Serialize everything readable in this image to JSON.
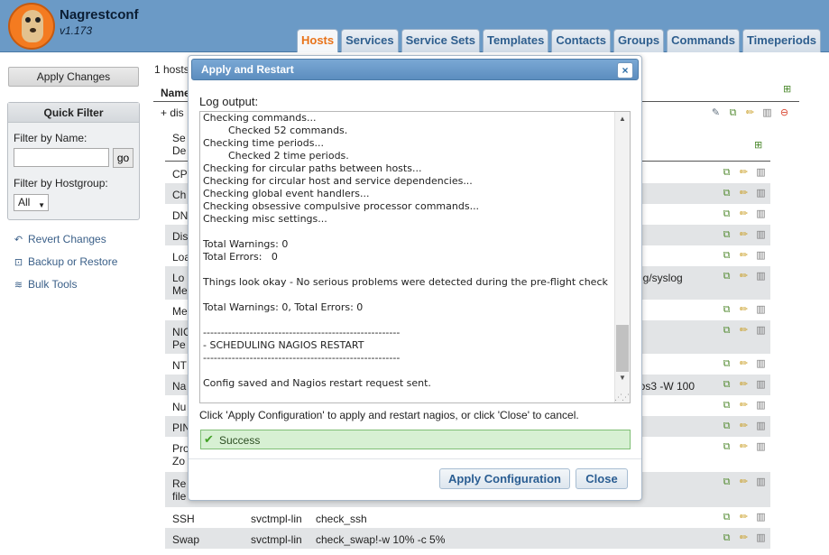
{
  "app": {
    "title": "Nagrestconf",
    "version": "v1.173"
  },
  "tabs": [
    {
      "label": "Hosts",
      "active": true
    },
    {
      "label": "Services",
      "active": false
    },
    {
      "label": "Service Sets",
      "active": false
    },
    {
      "label": "Templates",
      "active": false
    },
    {
      "label": "Contacts",
      "active": false
    },
    {
      "label": "Groups",
      "active": false
    },
    {
      "label": "Commands",
      "active": false
    },
    {
      "label": "Timeperiods",
      "active": false
    }
  ],
  "sidebar": {
    "apply_changes": "Apply Changes",
    "quick_filter": {
      "title": "Quick Filter",
      "name_label": "Filter by Name:",
      "name_value": "",
      "go_label": "go",
      "hostgroup_label": "Filter by Hostgroup:",
      "hostgroup_value": "All"
    },
    "links": [
      {
        "label": "Revert Changes",
        "icon": "revert-icon"
      },
      {
        "label": "Backup or Restore",
        "icon": "backup-icon"
      },
      {
        "label": "Bulk Tools",
        "icon": "stack-icon"
      }
    ]
  },
  "main": {
    "hosts_count": "1 hosts",
    "column_name": "Name",
    "host_row_label": "+ dis",
    "services_header": "Se\nDe",
    "rows": [
      {
        "c1": "CP",
        "c2": "",
        "c3": "",
        "c4": ""
      },
      {
        "c1": "Ch",
        "c2": "",
        "c3": "",
        "c4": ""
      },
      {
        "c1": "DN",
        "c2": "",
        "c3": "",
        "c4": ""
      },
      {
        "c1": "Dis",
        "c2": "",
        "c3": "",
        "c4": ""
      },
      {
        "c1": "Loa",
        "c2": "",
        "c3": "",
        "c4": ""
      },
      {
        "c1": "Lo\nMe",
        "c2": "",
        "c3": "",
        "c4": "og/syslog"
      },
      {
        "c1": "Me",
        "c2": "",
        "c3": "",
        "c4": ""
      },
      {
        "c1": "NIC\nPe",
        "c2": "",
        "c3": "",
        "c4": ""
      },
      {
        "c1": "NT",
        "c2": "",
        "c3": "",
        "c4": ""
      },
      {
        "c1": "Na",
        "c2": "",
        "c3": "",
        "c4": "ios3 -W 100"
      },
      {
        "c1": "Nu",
        "c2": "",
        "c3": "",
        "c4": ""
      },
      {
        "c1": "PIN",
        "c2": "",
        "c3": "",
        "c4": ""
      },
      {
        "c1": "Pro\nZo",
        "c2": "",
        "c3": "",
        "c4": ""
      },
      {
        "c1": "Re\nfile",
        "c2": "",
        "c3": "",
        "c4": ""
      },
      {
        "c1": "SSH",
        "c2": "svctmpl-lin",
        "c3": "check_ssh",
        "c4": ""
      },
      {
        "c1": "Swap",
        "c2": "svctmpl-lin",
        "c3": "check_swap!-w 10% -c 5%",
        "c4": ""
      },
      {
        "c1": "",
        "c2": "",
        "c3": "",
        "c4": ""
      }
    ]
  },
  "dialog": {
    "title": "Apply and Restart",
    "close_glyph": "×",
    "log_label": "Log output:",
    "log_text": "Checking commands...\n        Checked 52 commands.\nChecking time periods...\n        Checked 2 time periods.\nChecking for circular paths between hosts...\nChecking for circular host and service dependencies...\nChecking global event handlers...\nChecking obsessive compulsive processor commands...\nChecking misc settings...\n\nTotal Warnings: 0\nTotal Errors:   0\n\nThings look okay - No serious problems were detected during the pre-flight check\n\nTotal Warnings: 0, Total Errors: 0\n\n-------------------------------------------------------\n- SCHEDULING NAGIOS RESTART\n-------------------------------------------------------\n\nConfig saved and Nagios restart request sent.\n",
    "instructions": "Click 'Apply Configuration' to apply and restart nagios, or click 'Close' to cancel.",
    "status": "Success",
    "apply_button": "Apply Configuration",
    "close_button": "Close"
  },
  "colors": {
    "header_bg": "#6b9ac6",
    "active_tab": "#e8731a",
    "success_bg": "#d7f0d3",
    "dialog_titlebar": "#5c8dbf"
  }
}
